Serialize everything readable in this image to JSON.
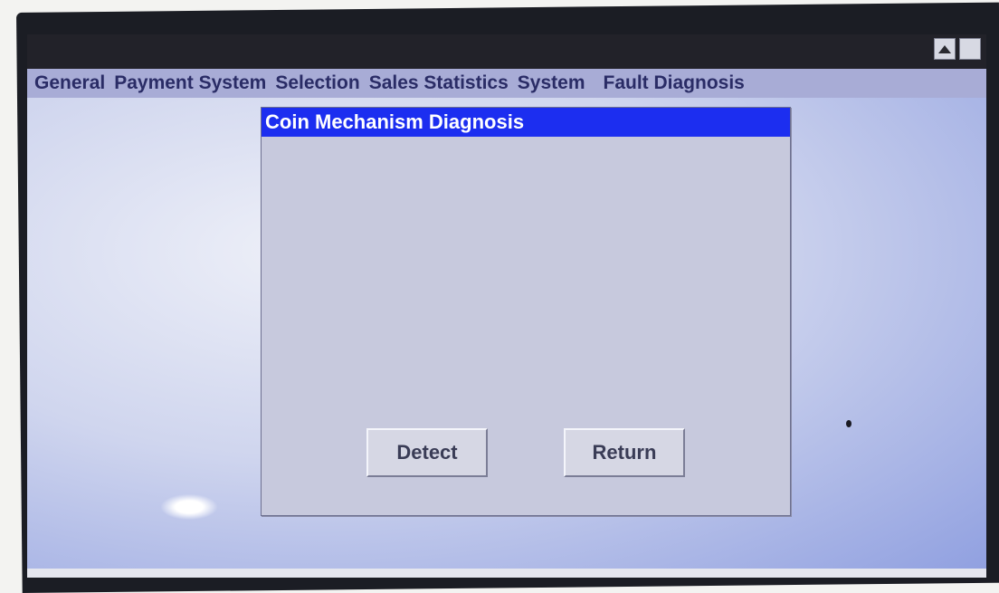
{
  "menubar": {
    "items": [
      {
        "label": "General"
      },
      {
        "label": "Payment System"
      },
      {
        "label": "Selection"
      },
      {
        "label": "Sales Statistics"
      },
      {
        "label": "System"
      },
      {
        "label": "Fault Diagnosis"
      }
    ]
  },
  "window_controls": {
    "scroll_up_icon": "triangle-up-icon",
    "blank_button_icon": "blank-square-icon"
  },
  "dialog": {
    "title": "Coin Mechanism Diagnosis",
    "detect_label": "Detect",
    "return_label": "Return"
  },
  "colors": {
    "title_bar": "#1c2ef0",
    "menubar": "#a8acd6",
    "dialog_bg": "#c7c9dd",
    "desktop": "#cfd5ee"
  }
}
